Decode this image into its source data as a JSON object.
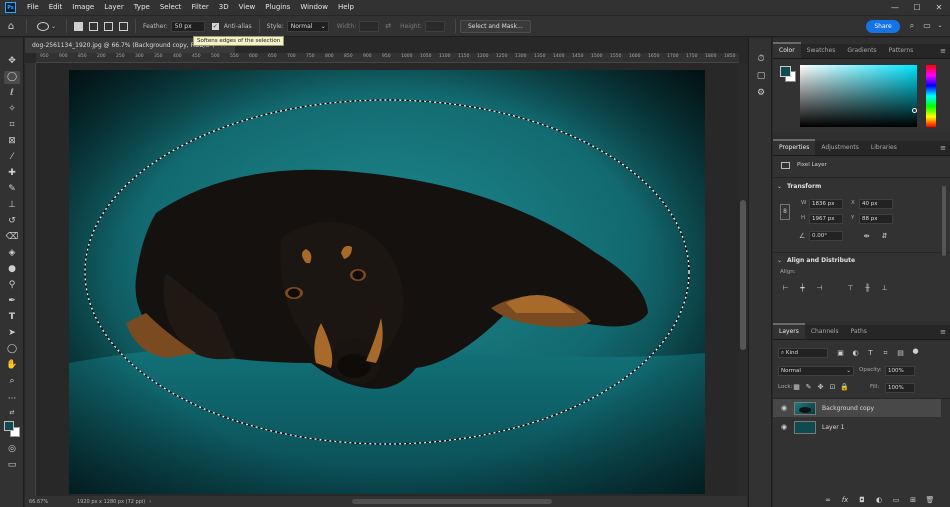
{
  "app": {
    "logo": "Ps",
    "menu": [
      "File",
      "Edit",
      "Image",
      "Layer",
      "Type",
      "Select",
      "Filter",
      "3D",
      "View",
      "Plugins",
      "Window",
      "Help"
    ],
    "window_controls": [
      "—",
      "☐",
      "✕"
    ]
  },
  "options_bar": {
    "feather_label": "Feather:",
    "feather_value": "50 px",
    "antialias_label": "Anti-alias",
    "style_label": "Style:",
    "style_value": "Normal",
    "width_label": "Width:",
    "height_label": "Height:",
    "select_mask_label": "Select and Mask...",
    "share_label": "Share",
    "tooltip": "Softens edges of the selection"
  },
  "document": {
    "tab_title": "dog-2561134_1920.jpg @ 66.7% (Background copy, RGB/8*)",
    "ruler_ticks": [
      "950",
      "900",
      "850",
      "200",
      "250",
      "300",
      "350",
      "400",
      "450",
      "500",
      "550",
      "600",
      "650",
      "700",
      "750",
      "800",
      "850",
      "900",
      "950",
      "1000",
      "1050",
      "1100",
      "1150",
      "1200",
      "1250",
      "1300",
      "1350",
      "1400",
      "1450",
      "1500",
      "1550",
      "1600",
      "1650",
      "1700",
      "1750",
      "1800",
      "1850"
    ],
    "zoom": "66.67%",
    "doc_info": "1920 px x 1280 px (72 ppi)"
  },
  "color_panel": {
    "tabs": [
      "Color",
      "Swatches",
      "Gradients",
      "Patterns"
    ],
    "fg_color": "#0f4a50",
    "bg_color": "#ffffff"
  },
  "properties_panel": {
    "tabs": [
      "Properties",
      "Adjustments",
      "Libraries"
    ],
    "layer_type": "Pixel Layer",
    "transform_title": "Transform",
    "w_label": "W",
    "w_value": "1836 px",
    "h_label": "H",
    "h_value": "1967 px",
    "x_label": "X",
    "x_value": "40 px",
    "y_label": "Y",
    "y_value": "88 px",
    "angle_value": "0.00°",
    "align_title": "Align and Distribute",
    "align_label": "Align:"
  },
  "layers_panel": {
    "tabs": [
      "Layers",
      "Channels",
      "Paths"
    ],
    "filter_value": "Kind",
    "blend_mode": "Normal",
    "opacity_label": "Opacity:",
    "opacity_value": "100%",
    "lock_label": "Lock:",
    "fill_label": "Fill:",
    "fill_value": "100%",
    "layers": [
      {
        "name": "Background copy",
        "selected": true
      },
      {
        "name": "Layer 1",
        "selected": false
      }
    ]
  }
}
